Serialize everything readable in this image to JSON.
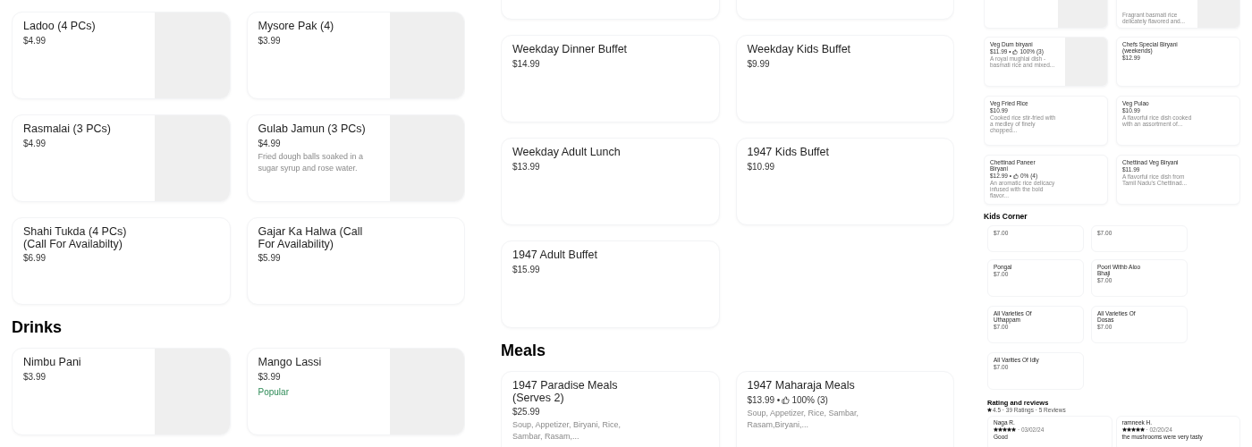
{
  "panels": [
    {
      "kind": "full",
      "blocks": [
        {
          "kind": "grid",
          "cut": false,
          "items": [
            {
              "name": "Ladoo (4  PCs)",
              "price": "$4.99",
              "has_image": true
            },
            {
              "name": "Mysore Pak (4)",
              "price": "$3.99",
              "has_image": true
            },
            {
              "name": "Rasmalai (3 PCs)",
              "price": "$4.99",
              "has_image": true
            },
            {
              "name": "Gulab Jamun (3 PCs)",
              "price": "$4.99",
              "description": "Fried dough balls soaked in a sugar syrup and rose water.",
              "has_image": true
            },
            {
              "name": "Shahi Tukda (4 PCs) (Call For Availabilty)",
              "price": "$6.99",
              "has_image": false
            },
            {
              "name": "Gajar Ka Halwa (Call For Availability)",
              "price": "$5.99",
              "has_image": false
            }
          ]
        },
        {
          "kind": "heading",
          "text": "Drinks"
        },
        {
          "kind": "grid",
          "cut": false,
          "items": [
            {
              "name": "Nimbu Pani",
              "price": "$3.99",
              "has_image": true
            },
            {
              "name": "Mango Lassi",
              "price": "$3.99",
              "badge": "Popular",
              "has_image": true
            }
          ]
        }
      ]
    },
    {
      "kind": "full",
      "blocks": [
        {
          "kind": "grid",
          "cut": true,
          "items": [
            {
              "has_image": false
            },
            {
              "has_image": false
            }
          ]
        },
        {
          "kind": "grid",
          "cut": false,
          "items": [
            {
              "name": "Weekday Dinner Buffet",
              "price": "$14.99",
              "has_image": false
            },
            {
              "name": "Weekday Kids Buffet",
              "price": "$9.99",
              "has_image": false
            },
            {
              "name": "Weekday Adult Lunch",
              "price": "$13.99",
              "has_image": false
            },
            {
              "name": "1947 Kids Buffet",
              "price": "$10.99",
              "has_image": false
            },
            {
              "name": "1947 Adult Buffet",
              "price": "$15.99",
              "has_image": false
            }
          ]
        },
        {
          "kind": "heading",
          "text": "Meals"
        },
        {
          "kind": "grid",
          "cut": false,
          "items": [
            {
              "name": "1947 Paradise Meals (Serves 2)",
              "price": "$25.99",
              "description": "Soup, Appetizer, Biryani, Rice, Sambar, Rasam,...",
              "has_image": false
            },
            {
              "name": "1947 Maharaja Meals",
              "price": "$13.99 •",
              "rating": "100% (3)",
              "description": "Soup, Appetizer, Rice, Sambar, Rasam,Biryani,...",
              "has_image": false
            }
          ]
        }
      ]
    },
    {
      "kind": "compact",
      "blocks": [
        {
          "kind": "grid",
          "cut": true,
          "items": [
            {
              "has_image": true
            },
            {
              "description": "Fragrant basmati rice delicately flavored and...",
              "has_image": true
            }
          ]
        },
        {
          "kind": "grid",
          "cut": false,
          "items": [
            {
              "name": "Veg Dum biryani",
              "price": "$11.99 •",
              "rating": "100% (3)",
              "description": "A royal mughlai dish - basmati rice and mixed...",
              "has_image": true
            },
            {
              "name": "Chefs Special Biryani (weekends)",
              "price": "$12.99",
              "has_image": false
            },
            {
              "name": "Veg Fried Rice",
              "price": "$10.99",
              "description": "Cooked rice stir-fried with a medley of finely chopped...",
              "has_image": false
            },
            {
              "name": "Veg Pulao",
              "price": "$10.99",
              "description": "A flavorful rice dish cooked with an assortment of...",
              "has_image": false
            },
            {
              "name": "Chettinad Paneer Biryani",
              "price": "$12.99 •",
              "rating": "0% (4)",
              "description": "An aromatic rice delicacy infused with the bold flavor...",
              "has_image": false
            },
            {
              "name": "Chettinad Veg Biryani",
              "price": "$11.99",
              "description": "A flavorful rice dish from Tamil Nadu's Chettinad...",
              "has_image": false
            }
          ]
        },
        {
          "kind": "heading",
          "text": "Kids Corner"
        },
        {
          "kind": "mini",
          "cut": true,
          "items": [
            {
              "price": "$7.00"
            },
            {
              "price": "$7.00"
            }
          ]
        },
        {
          "kind": "mini",
          "cut": false,
          "items": [
            {
              "name": "Pongal",
              "price": "$7.00"
            },
            {
              "name": "Poori Withb Aloo Bhaji",
              "price": "$7.00"
            },
            {
              "name": "All Varieties Of Uthappam",
              "price": "$7.00"
            },
            {
              "name": "All Varieties Of Dosas",
              "price": "$7.00"
            },
            {
              "name": "All Varities Of Idly",
              "price": "$7.00"
            }
          ]
        },
        {
          "kind": "reviews",
          "title": "Rating and reviews",
          "summary": "4.5 · 39 Ratings · 5 Reviews",
          "reviews": [
            {
              "author": "Naga R.",
              "stars": 5,
              "date": "· 03/02/24",
              "text": "Good"
            },
            {
              "author": "ramneek H.",
              "stars": 5,
              "date": "· 02/20/24",
              "text": "the mushrooms were very tasty"
            }
          ]
        }
      ]
    }
  ]
}
